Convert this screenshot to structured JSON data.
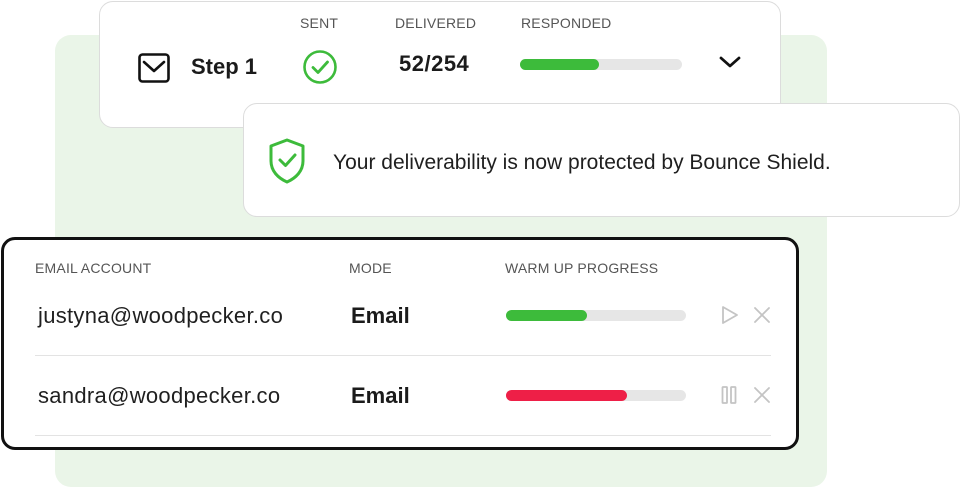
{
  "step": {
    "label": "Step 1",
    "headers": {
      "sent": "SENT",
      "delivered": "DELIVERED",
      "responded": "RESPONDED"
    },
    "delivered_value": "52/254",
    "responded_progress": 0.49,
    "accent_color": "#3dbb3b"
  },
  "toast": {
    "message": "Your deliverability is now protected by Bounce Shield.",
    "icon": "shield-check-icon",
    "icon_color": "#3dbb3b"
  },
  "accounts": {
    "headers": {
      "email": "EMAIL ACCOUNT",
      "mode": "MODE",
      "progress": "WARM UP PROGRESS"
    },
    "rows": [
      {
        "email": "justyna@woodpecker.co",
        "mode": "Email",
        "progress": 0.45,
        "color": "#3dbb3b",
        "control_icon": "play-icon"
      },
      {
        "email": "sandra@woodpecker.co",
        "mode": "Email",
        "progress": 0.67,
        "color": "#ee1f47",
        "control_icon": "pause-icon"
      }
    ]
  }
}
